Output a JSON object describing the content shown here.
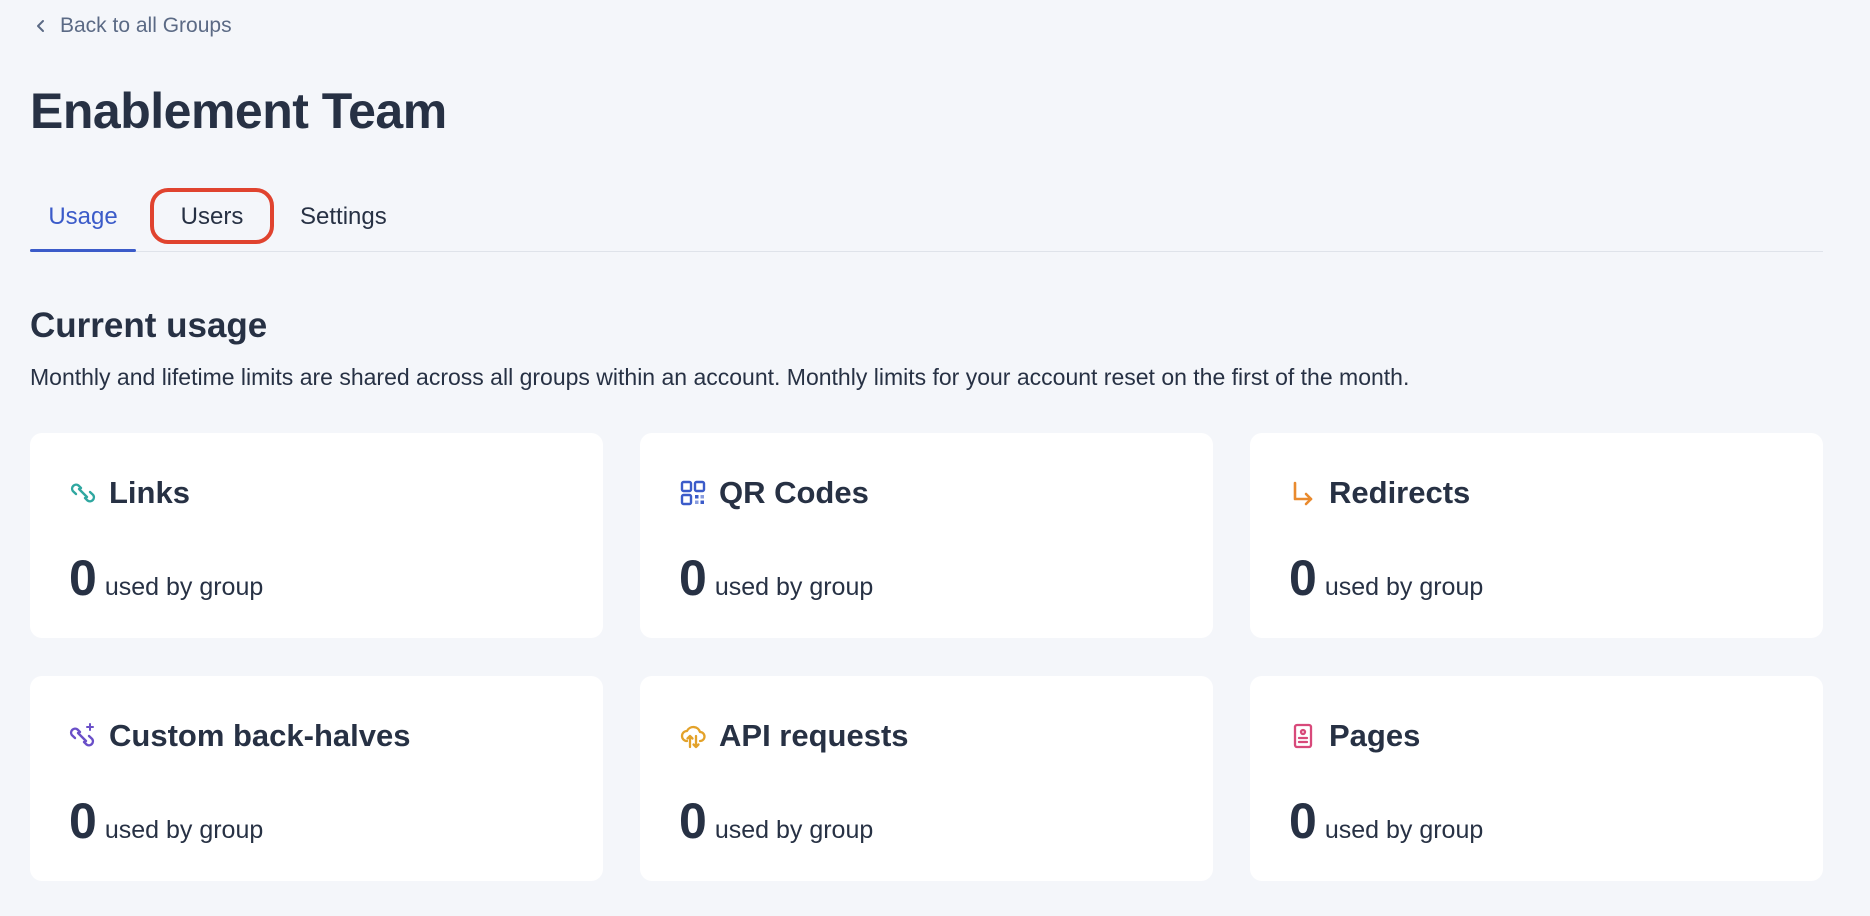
{
  "nav": {
    "back_label": "Back to all Groups"
  },
  "page": {
    "title": "Enablement Team"
  },
  "tabs": [
    {
      "label": "Usage",
      "active": true
    },
    {
      "label": "Users",
      "active": false
    },
    {
      "label": "Settings",
      "active": false
    }
  ],
  "usage": {
    "title": "Current usage",
    "description": "Monthly and lifetime limits are shared across all groups within an account. Monthly limits for your account reset on the first of the month.",
    "cards": [
      {
        "title": "Links",
        "icon": "link-icon",
        "icon_color": "#2fa7a0",
        "count": "0",
        "label": "used by group"
      },
      {
        "title": "QR Codes",
        "icon": "qr-code-icon",
        "icon_color": "#3b5bc9",
        "count": "0",
        "label": "used by group"
      },
      {
        "title": "Redirects",
        "icon": "redirect-arrow-icon",
        "icon_color": "#e98a2e",
        "count": "0",
        "label": "used by group"
      },
      {
        "title": "Custom back-halves",
        "icon": "sparkle-link-icon",
        "icon_color": "#6a4fc8",
        "count": "0",
        "label": "used by group"
      },
      {
        "title": "API requests",
        "icon": "cloud-transfer-icon",
        "icon_color": "#e3a22a",
        "count": "0",
        "label": "used by group"
      },
      {
        "title": "Pages",
        "icon": "page-icon",
        "icon_color": "#d8497a",
        "count": "0",
        "label": "used by group"
      }
    ]
  }
}
